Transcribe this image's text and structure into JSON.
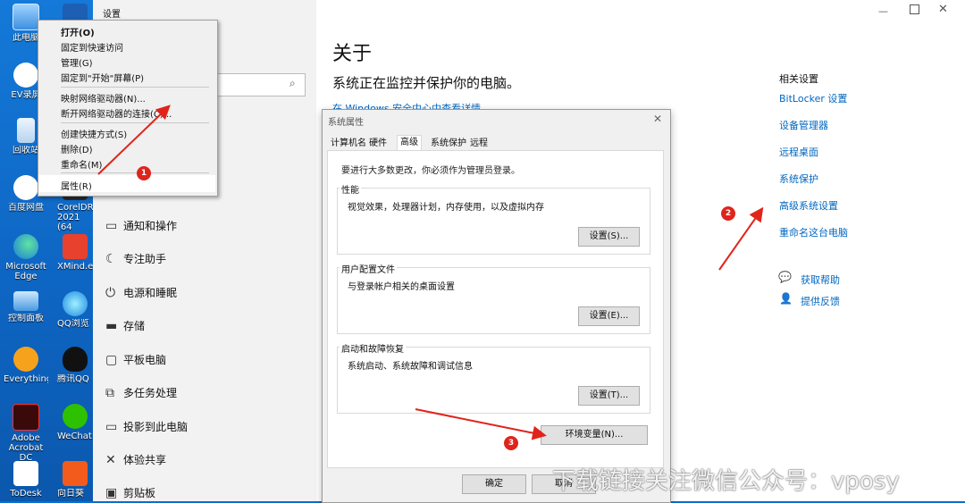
{
  "desktop": {
    "icons": [
      {
        "label": "此电脑"
      },
      {
        "label": "EV录屏"
      },
      {
        "label": "回收站"
      },
      {
        "label": "百度网盘"
      },
      {
        "label": "Microsoft Edge"
      },
      {
        "label": "控制面板"
      },
      {
        "label": "Everything"
      },
      {
        "label": "Adobe Acrobat DC"
      },
      {
        "label": "ToDesk"
      },
      {
        "label": "CorelDRAW 2021 (64"
      },
      {
        "label": "XMind.e"
      },
      {
        "label": "QQ浏览"
      },
      {
        "label": "腾讯QQ"
      },
      {
        "label": "WeChat."
      },
      {
        "label": "向日葵"
      }
    ]
  },
  "context_menu": {
    "items": [
      "打开(O)",
      "固定到快速访问",
      "管理(G)",
      "固定到\"开始\"屏幕(P)",
      "映射网络驱动器(N)...",
      "断开网络驱动器的连接(C)...",
      "创建快捷方式(S)",
      "删除(D)",
      "重命名(M)",
      "属性(R)"
    ]
  },
  "settings": {
    "window_title": "设置",
    "nav_items": [
      "通知和操作",
      "专注助手",
      "电源和睡眠",
      "存储",
      "平板电脑",
      "多任务处理",
      "投影到此电脑",
      "体验共享",
      "剪贴板"
    ],
    "page_title": "关于",
    "subtitle": "系统正在监控并保护你的电脑。",
    "partial_link": "在 Windows 安全中心中查看详情",
    "related_title": "相关设置",
    "related_links": [
      "BitLocker 设置",
      "设备管理器",
      "远程桌面",
      "系统保护",
      "高级系统设置",
      "重命名这台电脑"
    ],
    "help_links": [
      "获取帮助",
      "提供反馈"
    ]
  },
  "dialog": {
    "title": "系统属性",
    "tabs": [
      "计算机名",
      "硬件",
      "高级",
      "系统保护",
      "远程"
    ],
    "admin_note": "要进行大多数更改，你必须作为管理员登录。",
    "groups": [
      {
        "title": "性能",
        "desc": "视觉效果，处理器计划，内存使用，以及虚拟内存",
        "button": "设置(S)..."
      },
      {
        "title": "用户配置文件",
        "desc": "与登录帐户相关的桌面设置",
        "button": "设置(E)..."
      },
      {
        "title": "启动和故障恢复",
        "desc": "系统启动、系统故障和调试信息",
        "button": "设置(T)..."
      }
    ],
    "env_button": "环境变量(N)...",
    "ok_button": "确定",
    "cancel_button": "取消"
  },
  "annotations": [
    "1",
    "2",
    "3"
  ],
  "watermark": "下载链接关注微信公众号：vposy",
  "colors": {
    "arrow": "#e0241b",
    "link": "#0067c0",
    "desktop": "#0e66c4"
  }
}
